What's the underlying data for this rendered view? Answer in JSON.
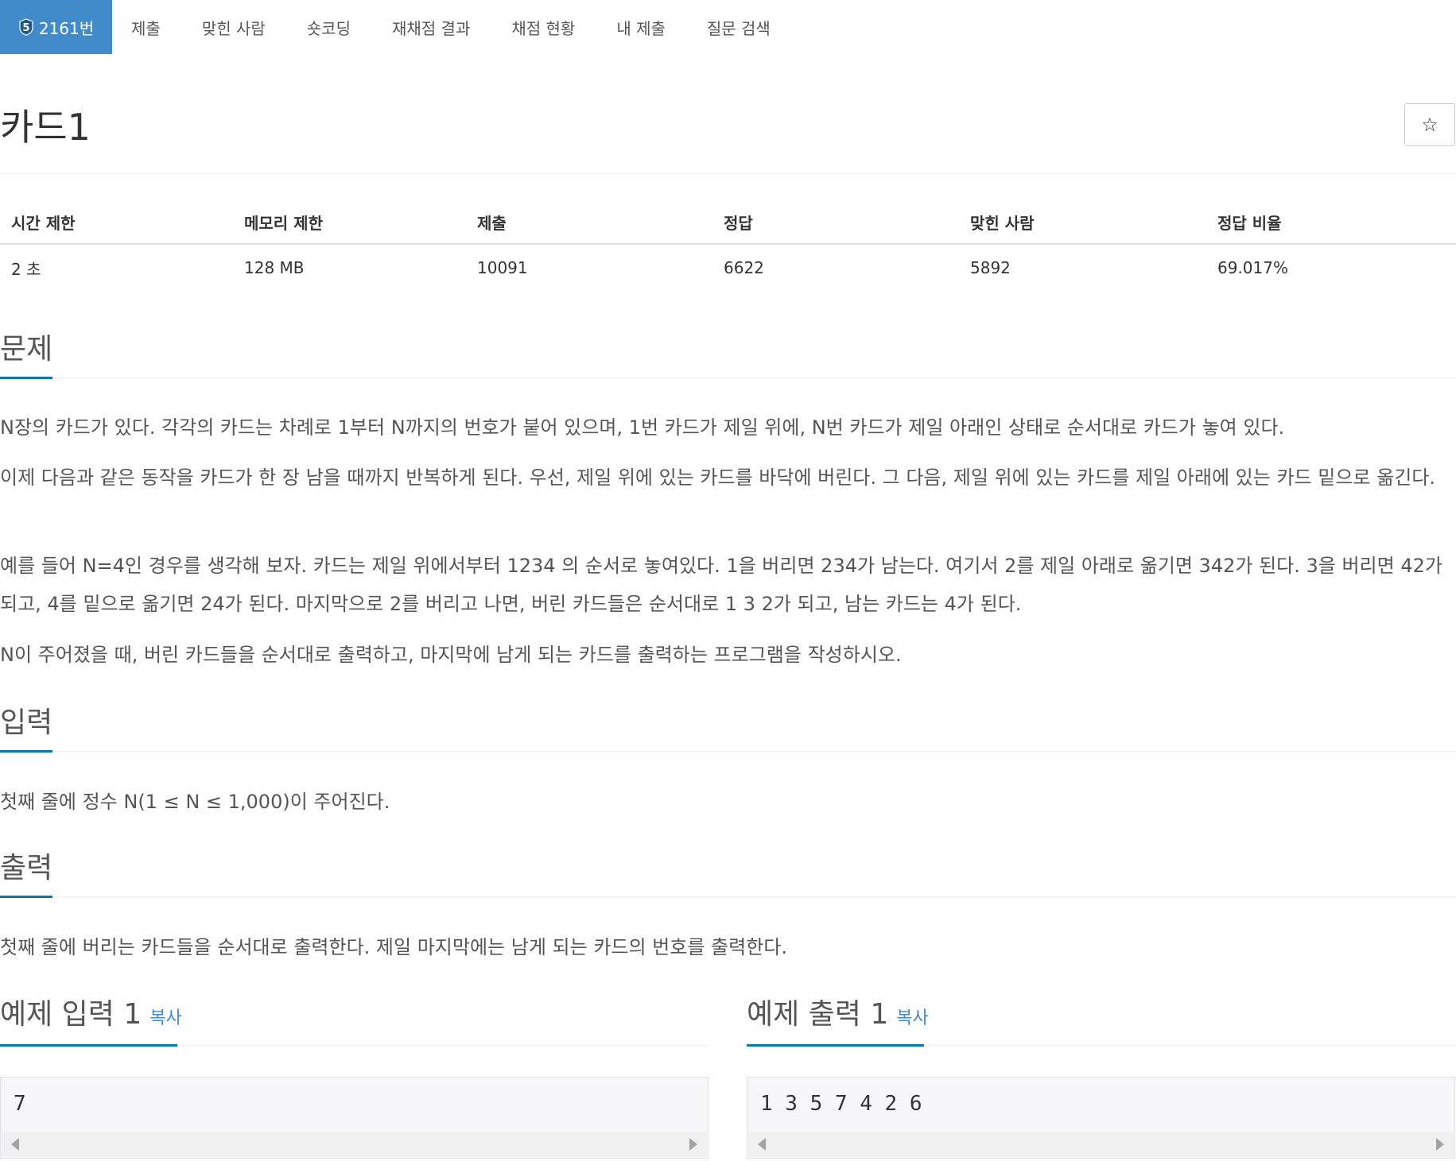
{
  "nav": {
    "active_tab": {
      "badge": "5",
      "label": "2161번"
    },
    "tabs": [
      "제출",
      "맞힌 사람",
      "숏코딩",
      "재채점 결과",
      "채점 현황",
      "내 제출",
      "질문 검색"
    ]
  },
  "problem": {
    "title": "카드1",
    "star_icon": "☆"
  },
  "info_table": {
    "headers": [
      "시간 제한",
      "메모리 제한",
      "제출",
      "정답",
      "맞힌 사람",
      "정답 비율"
    ],
    "values": [
      "2 초",
      "128 MB",
      "10091",
      "6622",
      "5892",
      "69.017%"
    ]
  },
  "sections": {
    "problem": {
      "heading": "문제",
      "paragraphs": [
        "N장의 카드가 있다. 각각의 카드는 차례로 1부터 N까지의 번호가 붙어 있으며, 1번 카드가 제일 위에, N번 카드가 제일 아래인 상태로 순서대로 카드가 놓여 있다.",
        "이제 다음과 같은 동작을 카드가 한 장 남을 때까지 반복하게 된다. 우선, 제일 위에 있는 카드를 바닥에 버린다. 그 다음, 제일 위에 있는 카드를 제일 아래에 있는 카드 밑으로 옮긴다.",
        "예를 들어 N=4인 경우를 생각해 보자. 카드는 제일 위에서부터 1234 의 순서로 놓여있다. 1을 버리면 234가 남는다. 여기서 2를 제일 아래로 옮기면 342가 된다. 3을 버리면 42가 되고, 4를 밑으로 옮기면 24가 된다. 마지막으로 2를 버리고 나면, 버린 카드들은 순서대로 1 3 2가 되고, 남는 카드는 4가 된다.",
        "N이 주어졌을 때, 버린 카드들을 순서대로 출력하고, 마지막에 남게 되는 카드를 출력하는 프로그램을 작성하시오."
      ]
    },
    "input": {
      "heading": "입력",
      "text": "첫째 줄에 정수 N(1 ≤ N ≤ 1,000)이 주어진다."
    },
    "output": {
      "heading": "출력",
      "text": "첫째 줄에 버리는 카드들을 순서대로 출력한다. 제일 마지막에는 남게 되는 카드의 번호를 출력한다."
    }
  },
  "samples": {
    "input": {
      "heading": "예제 입력 1",
      "copy": "복사",
      "content": "7"
    },
    "output": {
      "heading": "예제 출력 1",
      "copy": "복사",
      "content": "1 3 5 7 4 2 6"
    }
  },
  "colors": {
    "accent": "#428bca",
    "heading_underline": "#0e76a8"
  }
}
